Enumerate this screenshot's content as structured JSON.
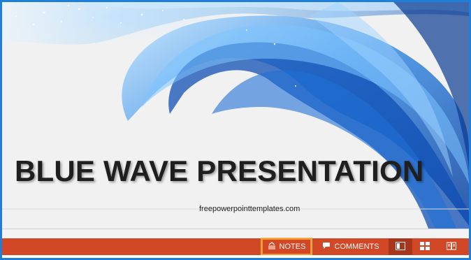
{
  "slide": {
    "title": "BLUE WAVE PRESENTATION",
    "subtitle": "freepowerpointtemplates.com"
  },
  "statusbar": {
    "notes_label": "NOTES",
    "comments_label": "COMMENTS",
    "accent_color": "#d24726",
    "highlight_color": "#f39a2c",
    "view_buttons": [
      {
        "name": "normal-view",
        "icon": "normal-view-icon",
        "active": true
      },
      {
        "name": "slide-sorter",
        "icon": "slide-sorter-icon",
        "active": false
      },
      {
        "name": "reading-view",
        "icon": "reading-view-icon",
        "active": false
      }
    ]
  },
  "colors": {
    "frame_border": "#1f7fd8",
    "wave_blue": "#1a66c8"
  }
}
